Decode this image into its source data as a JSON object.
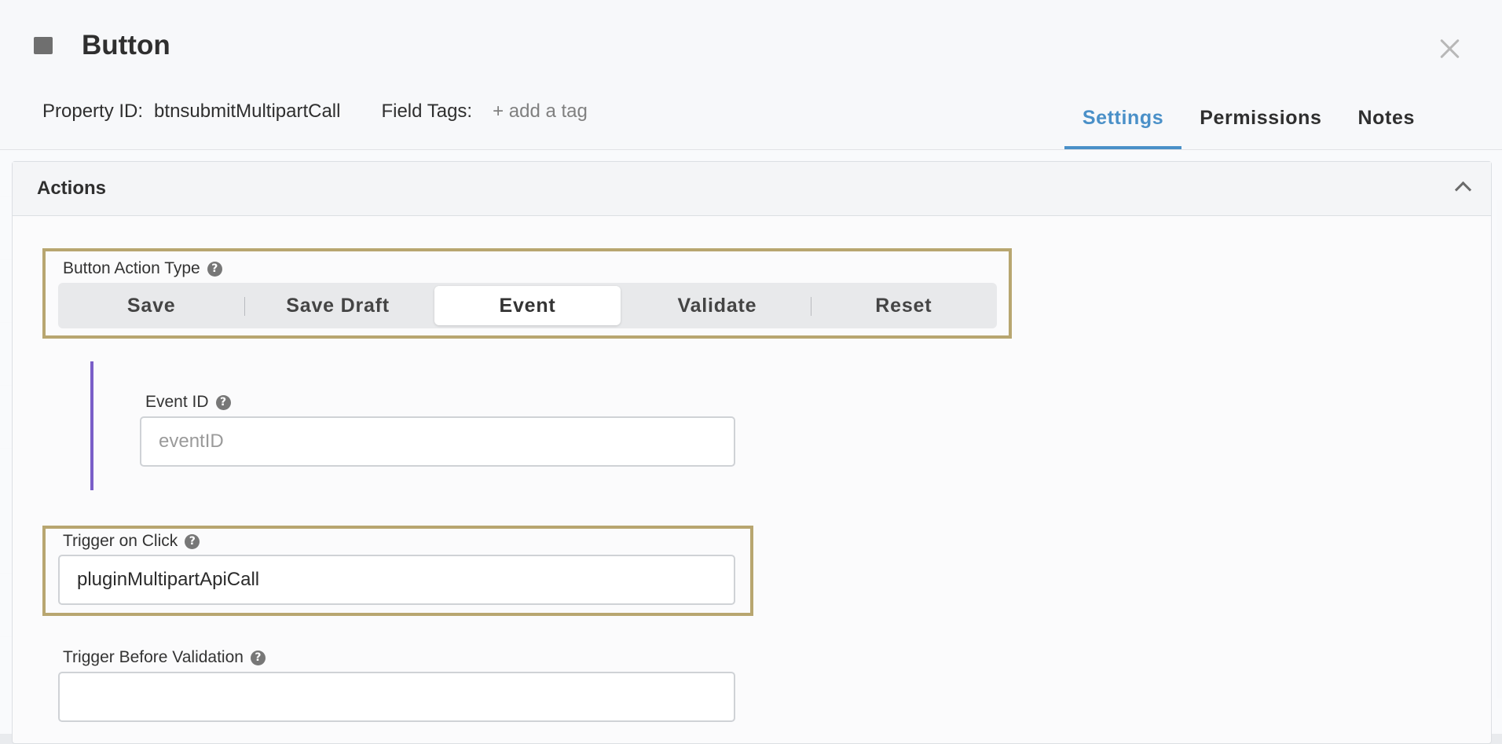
{
  "header": {
    "icon": "square-icon",
    "title": "Button",
    "property_id_label": "Property ID:",
    "property_id_value": "btnsubmitMultipartCall",
    "field_tags_label": "Field Tags:",
    "add_tag_label": "+ add a tag",
    "tabs": [
      {
        "label": "Settings",
        "active": true
      },
      {
        "label": "Permissions",
        "active": false
      },
      {
        "label": "Notes",
        "active": false
      }
    ]
  },
  "actions": {
    "title": "Actions",
    "button_action_type": {
      "label": "Button Action Type",
      "options": [
        "Save",
        "Save Draft",
        "Event",
        "Validate",
        "Reset"
      ],
      "selected": "Event"
    },
    "event_id": {
      "label": "Event ID",
      "value": "",
      "placeholder": "eventID"
    },
    "trigger_on_click": {
      "label": "Trigger on Click",
      "value": "pluginMultipartApiCall"
    },
    "trigger_before_validation": {
      "label": "Trigger Before Validation",
      "value": ""
    }
  },
  "colors": {
    "accent": "#4a90c8",
    "highlight": "#b8a670",
    "sub_bar": "#7a5ec8"
  }
}
